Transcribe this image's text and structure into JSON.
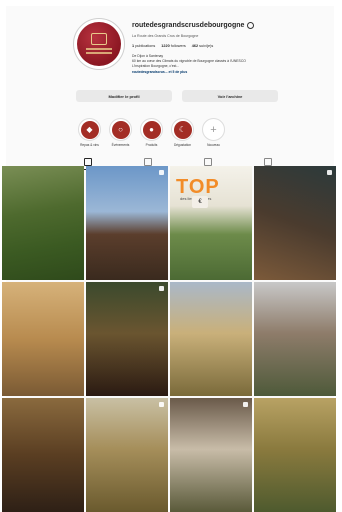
{
  "profile": {
    "username": "routedesgrandscrusdebourgogne",
    "subtitle": "La Route des Grands Crus de Bourgogne",
    "stats": [
      {
        "value": "1",
        "label": "publications"
      },
      {
        "value": "1220",
        "label": "followers"
      },
      {
        "value": "462",
        "label": "suivi(e)s"
      }
    ],
    "bio_lines": [
      "De Dijon à Santenay",
      "60 km au cœur des Climats du vignoble de Bourgogne classés à l'UNESCO",
      "L'inspiration Bourgogne, c'est..."
    ],
    "link": "routedesgrandscrus... et 5 de plus"
  },
  "buttons": {
    "edit": "Modifier le profil",
    "share": "Voir l'archive"
  },
  "highlights": [
    {
      "label": "Repas & vins",
      "icon": "wine-icon"
    },
    {
      "label": "Événements",
      "icon": "magnifier-icon"
    },
    {
      "label": "Produits",
      "icon": "food-icon"
    },
    {
      "label": "Dégustation",
      "icon": "moon-icon"
    },
    {
      "label": "Nouveau",
      "icon": "plus-icon"
    }
  ],
  "tabs": [
    "Publications",
    "Reels",
    "Guide",
    "Identifié"
  ],
  "grid_tiles": [
    {
      "label": "Vignoble de Bourgogne vue aérienne"
    },
    {
      "label": "Château toit vernissé"
    },
    {
      "label": "TOP"
    },
    {
      "label": "Rayonnage de bouteilles"
    },
    {
      "label": "Salle de réception"
    },
    {
      "label": "Dégustation en cave"
    },
    {
      "label": "Balade dans les vignes"
    },
    {
      "label": "Château et jardins"
    },
    {
      "label": "Salle historique"
    },
    {
      "label": "Vendanges"
    },
    {
      "label": "Dégustation de rue"
    },
    {
      "label": "Promenade vigneronne"
    }
  ],
  "top_tile": {
    "title": "TOP",
    "subtitle": "des lieux insolites",
    "tag": "€"
  }
}
